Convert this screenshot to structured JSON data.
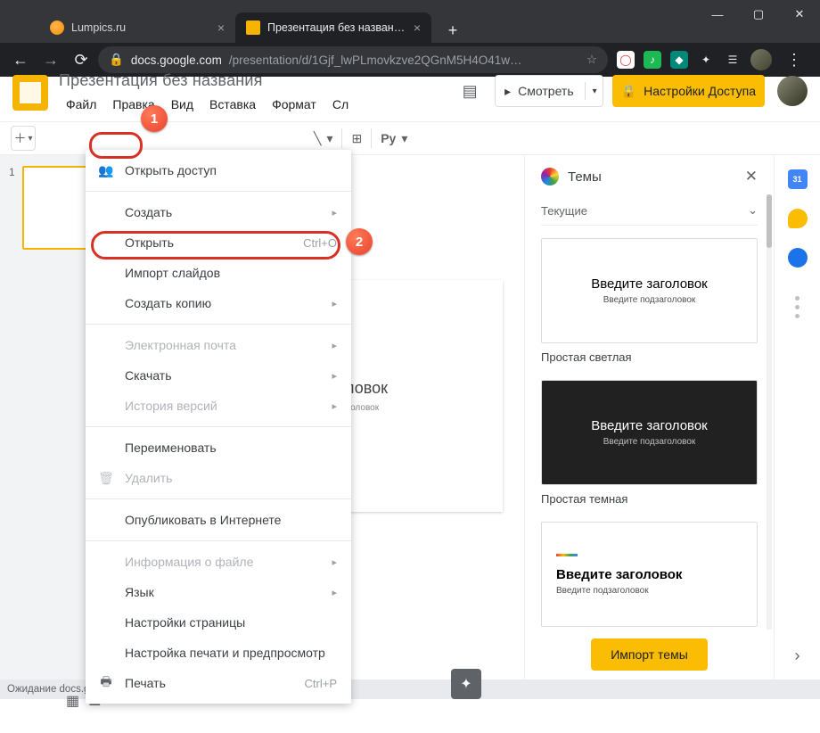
{
  "browser": {
    "tabs": [
      {
        "title": "Lumpics.ru"
      },
      {
        "title": "Презентация без названия - Go"
      }
    ],
    "url_domain": "docs.google.com",
    "url_path": "/presentation/d/1Gjf_lwPLmovkzve2QGnM5H4O41w…",
    "newtab": "+",
    "win": {
      "min": "—",
      "max": "▢",
      "close": "✕"
    }
  },
  "doc": {
    "title": "Презентация без названия",
    "menus": [
      "Файл",
      "Правка",
      "Вид",
      "Вставка",
      "Формат",
      "Сл"
    ],
    "present": "Смотреть",
    "share": "Настройки Доступа"
  },
  "toolbar": {
    "ruText": "Ру"
  },
  "filmstrip": {
    "slide1_num": "1"
  },
  "canvas": {
    "title": "заголовок",
    "sub": "подзаголовок"
  },
  "themes": {
    "header": "Темы",
    "current": "Текущие",
    "t1": {
      "h": "Введите заголовок",
      "s": "Введите подзаголовок",
      "name": "Простая светлая"
    },
    "t2": {
      "h": "Введите заголовок",
      "s": "Введите подзаголовок",
      "name": "Простая темная"
    },
    "t3": {
      "h": "Введите заголовок",
      "s": "Введите подзаголовок"
    },
    "import": "Импорт темы"
  },
  "menu": {
    "share": "Открыть доступ",
    "create": "Создать",
    "open": "Открыть",
    "open_sc": "Ctrl+O",
    "import_slides": "Импорт слайдов",
    "make_copy": "Создать копию",
    "email": "Электронная почта",
    "download": "Скачать",
    "history": "История версий",
    "rename": "Переименовать",
    "delete": "Удалить",
    "publish": "Опубликовать в Интернете",
    "fileinfo": "Информация о файле",
    "language": "Язык",
    "page_setup": "Настройки страницы",
    "print_setup": "Настройка печати и предпросмотр",
    "print": "Печать",
    "print_sc": "Ctrl+P"
  },
  "status": "Ожидание docs.google.com…",
  "callouts": {
    "b1": "1",
    "b2": "2"
  },
  "rail": {
    "cal": "31"
  }
}
